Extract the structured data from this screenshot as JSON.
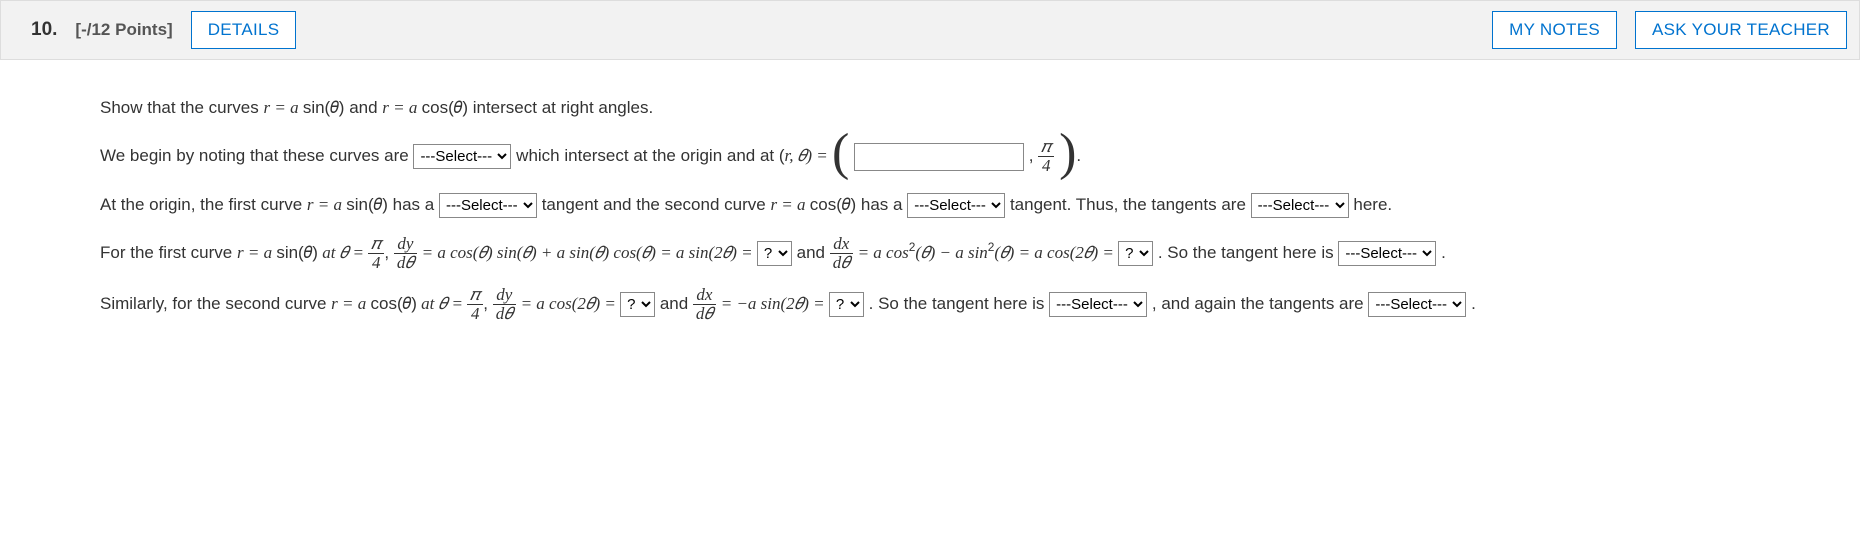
{
  "header": {
    "number": "10.",
    "points": "[-/12 Points]",
    "details": "DETAILS",
    "mynotes": "MY NOTES",
    "ask": "ASK YOUR TEACHER"
  },
  "prompt": "Show that the curves ",
  "prompt_m1": "r = a ",
  "sin": "sin(𝜃)",
  "and": " and ",
  "prompt_m2": "r = a ",
  "cos": "cos(𝜃)",
  "prompt_end": " intersect at right angles.",
  "l2a": "We begin by noting that these curves are ",
  "l2b": " which intersect at the origin and at (",
  "r": "r",
  "comma": ", 𝜃) = ",
  "pi": "𝜋",
  "four": "4",
  "period": ".",
  "l3a": "At the origin, the first curve ",
  "hasa": " has a ",
  "tangent": " tangent",
  "l3b": " and the second curve ",
  "l3c": " tangent. Thus, the tangents are ",
  "here": " here.",
  "l4a": "For the first curve ",
  "ateq": " at 𝜃 = ",
  "l4b": " = ",
  "dy": "dy",
  "dth": "d𝜃",
  "dx": "dx",
  "eq1": " = a cos(𝜃) sin(𝜃) + a sin(𝜃) cos(𝜃) = a sin(2𝜃) = ",
  "andw": " and ",
  "eq2": " = a cos",
  "sq": "2",
  "eq2b": "(𝜃) − a sin",
  "eq2c": "(𝜃) = a cos(2𝜃) = ",
  "sotan": ". So the tangent here is ",
  "l5a": "Similarly, for the second curve ",
  "eq3": " = a cos(2𝜃) = ",
  "eq4": " = −a sin(2𝜃) = ",
  "sotan2": ". So the tangent here is ",
  "again": ", and again the tangents are ",
  "sel": "---Select---",
  "q": "?",
  "commaSep": ", "
}
